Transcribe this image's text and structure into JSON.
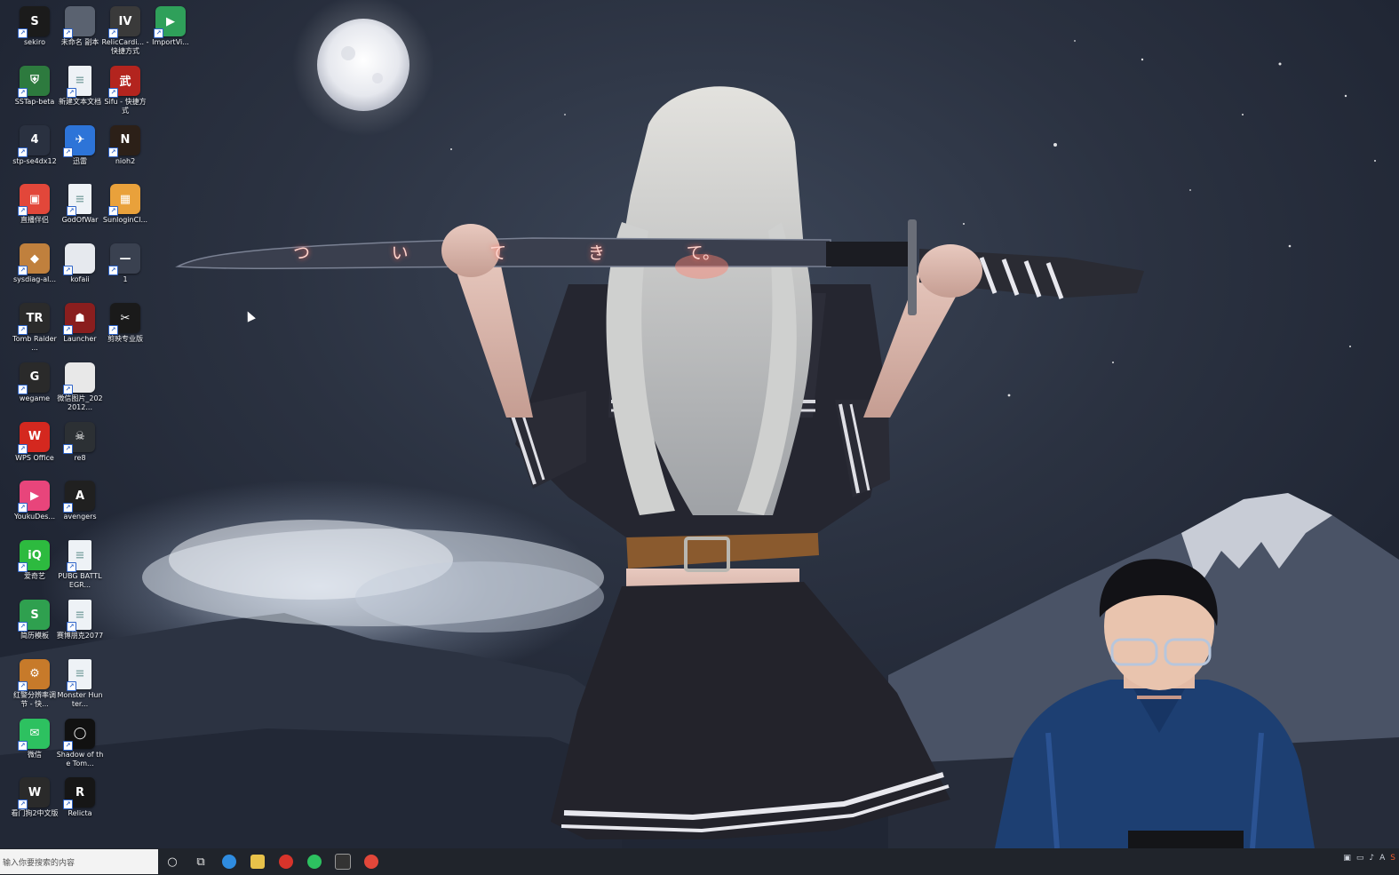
{
  "desktop_icons": [
    {
      "label": "sekiro",
      "color": "#1b1b1b",
      "glyph": "S",
      "col": 0,
      "row": 0
    },
    {
      "label": "未命名 副本",
      "color": "#5a6270",
      "glyph": "",
      "col": 1,
      "row": 0
    },
    {
      "label": "RelicCardi... - 快捷方式",
      "color": "#3a3a3a",
      "glyph": "IV",
      "col": 2,
      "row": 0
    },
    {
      "label": "ImportVi...",
      "color": "#2fa05a",
      "glyph": "▶",
      "col": 3,
      "row": 0
    },
    {
      "label": "SSTap-beta",
      "color": "#2d7a3e",
      "glyph": "⛨",
      "col": 0,
      "row": 1
    },
    {
      "label": "新建文本文档",
      "color": "doc",
      "glyph": "",
      "col": 1,
      "row": 1
    },
    {
      "label": "Sifu - 快捷方式",
      "color": "#b3241e",
      "glyph": "武",
      "col": 2,
      "row": 1
    },
    {
      "label": "stp-se4dx12",
      "color": "#2a3140",
      "glyph": "4",
      "col": 0,
      "row": 2
    },
    {
      "label": "迅雷",
      "color": "#2d74d8",
      "glyph": "✈",
      "col": 1,
      "row": 2
    },
    {
      "label": "nioh2",
      "color": "#2c2018",
      "glyph": "N",
      "col": 2,
      "row": 2
    },
    {
      "label": "直播伴侣",
      "color": "#e2473a",
      "glyph": "▣",
      "col": 0,
      "row": 3
    },
    {
      "label": "GodOfWar",
      "color": "doc",
      "glyph": "",
      "col": 1,
      "row": 3
    },
    {
      "label": "SunloginCl...",
      "color": "#e9a13b",
      "glyph": "▦",
      "col": 2,
      "row": 3
    },
    {
      "label": "sysdiag-al...",
      "color": "#c0803d",
      "glyph": "◆",
      "col": 0,
      "row": 4
    },
    {
      "label": "kofaii",
      "color": "#e6e9ee",
      "glyph": "",
      "col": 1,
      "row": 4
    },
    {
      "label": "1",
      "color": "#3a4150",
      "glyph": "—",
      "col": 2,
      "row": 4
    },
    {
      "label": "Tomb Raider ...",
      "color": "#2b2b2b",
      "glyph": "TR",
      "col": 0,
      "row": 5
    },
    {
      "label": "Launcher",
      "color": "#8a1e1e",
      "glyph": "☗",
      "col": 1,
      "row": 5
    },
    {
      "label": "剪映专业版",
      "color": "#1a1a1a",
      "glyph": "✂",
      "col": 2,
      "row": 5
    },
    {
      "label": "wegame",
      "color": "#2a2a2a",
      "glyph": "G",
      "col": 0,
      "row": 6
    },
    {
      "label": "微信图片_2022012...",
      "color": "#e8e8e8",
      "glyph": "",
      "col": 1,
      "row": 6
    },
    {
      "label": "WPS Office",
      "color": "#d4281f",
      "glyph": "W",
      "col": 0,
      "row": 7
    },
    {
      "label": "re8",
      "color": "#2c3034",
      "glyph": "☠",
      "col": 1,
      "row": 7
    },
    {
      "label": "YoukuDes...",
      "color": "#e8457b",
      "glyph": "▶",
      "col": 0,
      "row": 8
    },
    {
      "label": "avengers",
      "color": "#202020",
      "glyph": "A",
      "col": 1,
      "row": 8
    },
    {
      "label": "爱奇艺",
      "color": "#2dba3f",
      "glyph": "iQ",
      "col": 0,
      "row": 9
    },
    {
      "label": "PUBG BATTLEGR...",
      "color": "doc",
      "glyph": "",
      "col": 1,
      "row": 9
    },
    {
      "label": "简历模板",
      "color": "#2fa04f",
      "glyph": "S",
      "col": 0,
      "row": 10
    },
    {
      "label": "赛博朋克2077",
      "color": "doc",
      "glyph": "",
      "col": 1,
      "row": 10
    },
    {
      "label": "红警分辨率调节 - 快...",
      "color": "#c77a2a",
      "glyph": "⚙",
      "col": 0,
      "row": 11
    },
    {
      "label": "Monster Hunter...",
      "color": "doc",
      "glyph": "",
      "col": 1,
      "row": 11
    },
    {
      "label": "微信",
      "color": "#2dc160",
      "glyph": "✉",
      "col": 0,
      "row": 12
    },
    {
      "label": "Shadow of the Tom...",
      "color": "#111",
      "glyph": "◯",
      "col": 1,
      "row": 12
    },
    {
      "label": "看门狗2中文版",
      "color": "#2a2a2a",
      "glyph": "W",
      "col": 0,
      "row": 13
    },
    {
      "label": "Relicta",
      "color": "#161616",
      "glyph": "R",
      "col": 1,
      "row": 13
    }
  ],
  "wallpaper_text": [
    "つ",
    "い",
    "て",
    "き",
    "て。"
  ],
  "taskbar": {
    "search_placeholder": "输入你要搜索的内容",
    "apps": [
      {
        "name": "cortana-icon",
        "color": "#ffffff"
      },
      {
        "name": "task-view-icon",
        "color": "#ffffff"
      },
      {
        "name": "edge-icon",
        "color": "#2f8ce0"
      },
      {
        "name": "file-explorer-icon",
        "color": "#e8c24a"
      },
      {
        "name": "netease-music-icon",
        "color": "#d8342b"
      },
      {
        "name": "wechat-icon",
        "color": "#2dc160"
      },
      {
        "name": "epic-games-icon",
        "color": "#333333"
      },
      {
        "name": "livestream-icon",
        "color": "#e2473a"
      }
    ],
    "tray_text": "A"
  }
}
